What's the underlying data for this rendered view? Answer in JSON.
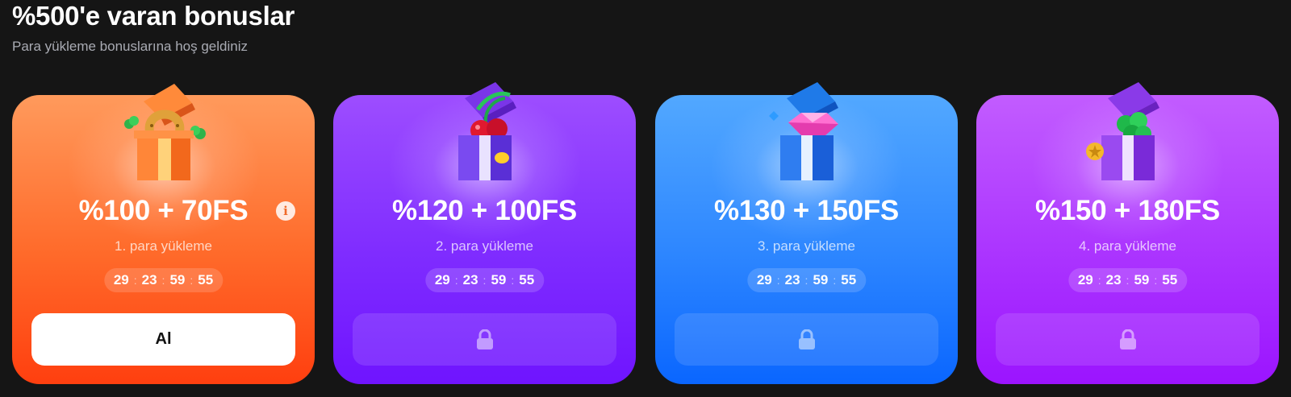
{
  "header": {
    "title": "%500'e varan bonuslar",
    "subtitle": "Para yükleme bonuslarına hoş geldiniz"
  },
  "cards": [
    {
      "amount": "%100 + 70FS",
      "label": "1. para yükleme",
      "timer": {
        "d": "29",
        "h": "23",
        "m": "59",
        "s": "55"
      },
      "button_label": "Al",
      "state": "available",
      "gift_icon": "horseshoe-gift-icon",
      "colors": {
        "top": "#ff9a5c",
        "bottom": "#ff3f0f"
      }
    },
    {
      "amount": "%120 + 100FS",
      "label": "2. para yükleme",
      "timer": {
        "d": "29",
        "h": "23",
        "m": "59",
        "s": "55"
      },
      "state": "locked",
      "gift_icon": "cherry-gift-icon",
      "colors": {
        "top": "#9d4dff",
        "bottom": "#6f14ff"
      }
    },
    {
      "amount": "%130 + 150FS",
      "label": "3. para yükleme",
      "timer": {
        "d": "29",
        "h": "23",
        "m": "59",
        "s": "55"
      },
      "state": "locked",
      "gift_icon": "diamond-gift-icon",
      "colors": {
        "top": "#52a8ff",
        "bottom": "#0a66ff"
      }
    },
    {
      "amount": "%150 + 180FS",
      "label": "4. para yükleme",
      "timer": {
        "d": "29",
        "h": "23",
        "m": "59",
        "s": "55"
      },
      "state": "locked",
      "gift_icon": "clover-gift-icon",
      "colors": {
        "top": "#c25cff",
        "bottom": "#9b14ff"
      }
    }
  ]
}
